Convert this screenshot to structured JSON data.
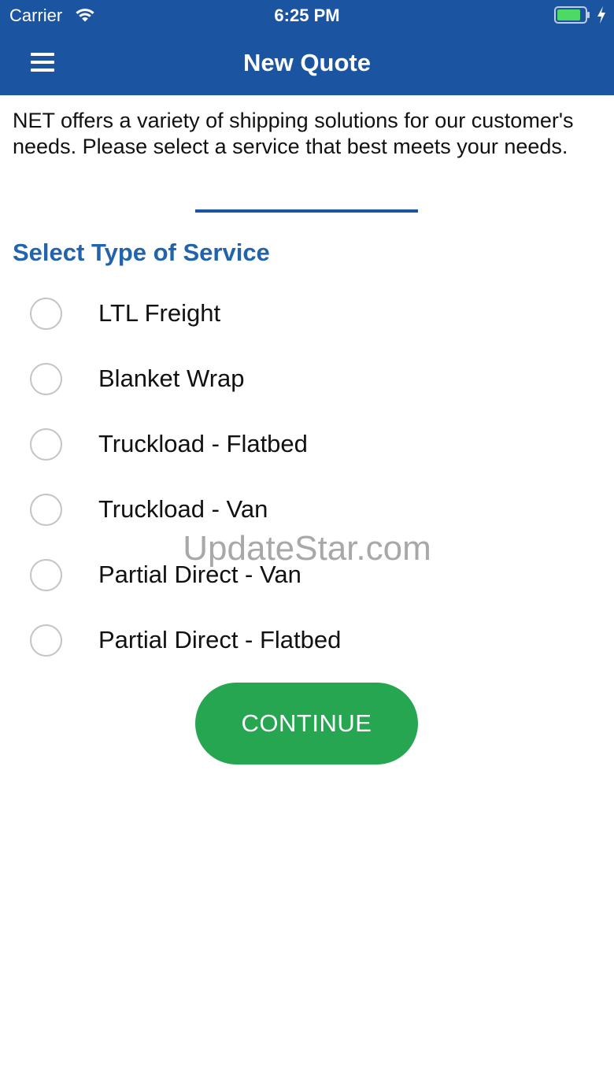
{
  "status_bar": {
    "carrier": "Carrier",
    "time": "6:25 PM",
    "icons": [
      "wifi-icon",
      "battery-icon",
      "charging-bolt-icon"
    ]
  },
  "nav": {
    "title": "New Quote",
    "menu_icon": "hamburger-menu-icon"
  },
  "intro": {
    "text": "NET offers a variety of shipping solutions for our customer's needs. Please select a service that best meets your needs."
  },
  "section": {
    "heading": "Select Type of Service"
  },
  "options": [
    {
      "label": "LTL Freight",
      "selected": false
    },
    {
      "label": "Blanket Wrap",
      "selected": false
    },
    {
      "label": "Truckload - Flatbed",
      "selected": false
    },
    {
      "label": "Truckload - Van",
      "selected": false
    },
    {
      "label": "Partial Direct - Van",
      "selected": false
    },
    {
      "label": "Partial Direct - Flatbed",
      "selected": false
    }
  ],
  "actions": {
    "continue_label": "CONTINUE"
  },
  "watermark": {
    "text": "UpdateStar.com"
  },
  "colors": {
    "header": "#1b54a0",
    "heading": "#2163ad",
    "button": "#26a651",
    "battery": "#4cd964"
  }
}
